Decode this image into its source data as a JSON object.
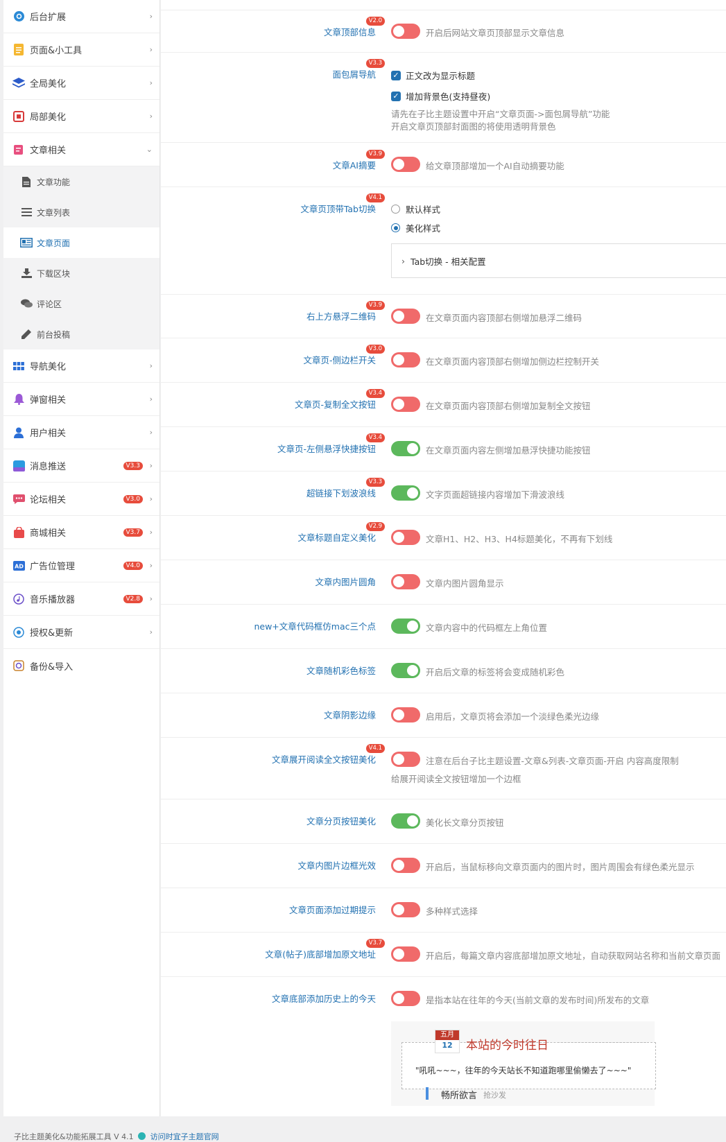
{
  "sidebar": {
    "items": [
      {
        "label": "后台扩展",
        "icon": "gear-circle-icon"
      },
      {
        "label": "页面&小工具",
        "icon": "document-icon"
      },
      {
        "label": "全局美化",
        "icon": "layers-icon"
      },
      {
        "label": "局部美化",
        "icon": "frame-icon"
      },
      {
        "label": "文章相关",
        "icon": "article-icon"
      },
      {
        "label": "导航美化",
        "icon": "grid-icon"
      },
      {
        "label": "弹窗相关",
        "icon": "bell-icon"
      },
      {
        "label": "用户相关",
        "icon": "user-icon"
      },
      {
        "label": "消息推送",
        "icon": "message-icon",
        "badge": "V3.3"
      },
      {
        "label": "论坛相关",
        "icon": "chat-icon",
        "badge": "V3.0"
      },
      {
        "label": "商城相关",
        "icon": "shop-bag-icon",
        "badge": "V3.7"
      },
      {
        "label": "广告位管理",
        "icon": "ad-icon",
        "badge": "V4.0"
      },
      {
        "label": "音乐播放器",
        "icon": "music-icon",
        "badge": "V2.8"
      },
      {
        "label": "授权&更新",
        "icon": "refresh-icon"
      },
      {
        "label": "备份&导入",
        "icon": "backup-icon"
      }
    ],
    "subitems": [
      {
        "label": "文章功能",
        "icon": "file-icon"
      },
      {
        "label": "文章列表",
        "icon": "list-icon"
      },
      {
        "label": "文章页面",
        "icon": "article-page-icon"
      },
      {
        "label": "下载区块",
        "icon": "download-icon"
      },
      {
        "label": "评论区",
        "icon": "comments-icon"
      },
      {
        "label": "前台投稿",
        "icon": "pencil-icon"
      }
    ]
  },
  "settings": {
    "header_info": {
      "label": "文章顶部信息",
      "badge": "V2.0",
      "desc": "开启后网站文章页顶部显示文章信息",
      "on": false
    },
    "breadcrumb": {
      "label": "面包屑导航",
      "badge": "V3.3",
      "opt1": "正文改为显示标题",
      "opt2": "增加背景色(支持昼夜)",
      "note1": "请先在子比主题设置中开启“文章页面->面包屑导航”功能",
      "note2": "开启文章页顶部封面图的将使用透明背景色"
    },
    "ai_summary": {
      "label": "文章AI摘要",
      "badge": "V3.9",
      "desc": "给文章顶部增加一个AI自动摘要功能",
      "on": false
    },
    "tab_switch": {
      "label": "文章页顶带Tab切换",
      "badge": "V4.1",
      "opt1": "默认样式",
      "opt2": "美化样式",
      "accordion": "Tab切换 - 相关配置"
    },
    "qrcode": {
      "label": "右上方悬浮二维码",
      "badge": "V3.9",
      "desc": "在文章页面内容顶部右侧增加悬浮二维码",
      "on": false
    },
    "sidebar_switch": {
      "label": "文章页-侧边栏开关",
      "badge": "V3.0",
      "desc": "在文章页面内容顶部右侧增加侧边栏控制开关",
      "on": false
    },
    "copy_all": {
      "label": "文章页-复制全文按钮",
      "badge": "V3.4",
      "desc": "在文章页面内容顶部右侧增加复制全文按钮",
      "on": false
    },
    "left_float": {
      "label": "文章页-左侧悬浮快捷按钮",
      "badge": "V3.4",
      "desc": "在文章页面内容左侧增加悬浮快捷功能按钮",
      "on": true
    },
    "wave_link": {
      "label": "超链接下划波浪线",
      "badge": "V3.3",
      "desc": "文字页面超链接内容增加下滑波浪线",
      "on": true
    },
    "heading": {
      "label": "文章标题自定义美化",
      "badge": "V2.9",
      "desc": "文章H1、H2、H3、H4标题美化，不再有下划线",
      "on": false
    },
    "img_round": {
      "label": "文章内图片圆角",
      "desc": "文章内图片圆角显示",
      "on": false
    },
    "mac_dots": {
      "label": "new+文章代码框仿mac三个点",
      "desc": "文章内容中的代码框左上角位置",
      "on": true
    },
    "random_tags": {
      "label": "文章随机彩色标签",
      "desc": "开启后文章的标签将会变成随机彩色",
      "on": true
    },
    "shadow": {
      "label": "文章阴影边缘",
      "desc": "启用后，文章页将会添加一个淡绿色柔光边缘",
      "on": false
    },
    "read_more": {
      "label": "文章展开阅读全文按钮美化",
      "badge": "V4.1",
      "desc": "注意在后台子比主题设置-文章&列表-文章页面-开启 内容高度限制",
      "desc2": "给展开阅读全文按钮增加一个边框",
      "on": false
    },
    "pagination": {
      "label": "文章分页按钮美化",
      "desc": "美化长文章分页按钮",
      "on": true
    },
    "img_glow": {
      "label": "文章内图片边框光效",
      "desc": "开启后，当鼠标移向文章页面内的图片时，图片周围会有绿色柔光显示",
      "on": false
    },
    "expired": {
      "label": "文章页面添加过期提示",
      "desc": "多种样式选择",
      "on": false
    },
    "source_url": {
      "label": "文章(帖子)底部增加原文地址",
      "badge": "V3.7",
      "desc": "开启后，每篇文章内容底部增加原文地址，自动获取网站名称和当前文章页面",
      "on": false
    },
    "history_today": {
      "label": "文章底部添加历史上的今天",
      "desc": "是指本站在往年的今天(当前文章的发布时间)所发布的文章",
      "on": false
    }
  },
  "preview": {
    "month": "五月",
    "day": "12",
    "title": "本站的今时往日",
    "message": "\"吼吼~~~，往年的今天站长不知道跑哪里偷懒去了~~~\"",
    "comment_name": "畅所欲言",
    "comment_link": "抢沙发"
  },
  "footer": {
    "text": "子比主题美化&功能拓展工具 V 4.1",
    "link": "访问时宜子主题官网"
  },
  "colors": {
    "accent": "#2271b1",
    "toggle_on": "#5cb85c",
    "toggle_off": "#f06a6a",
    "badge": "#e74c3c"
  }
}
